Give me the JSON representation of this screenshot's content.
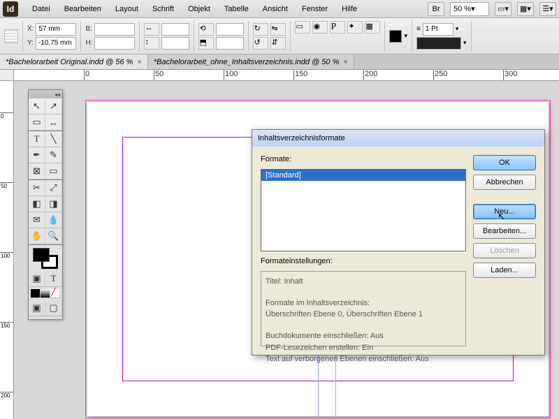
{
  "app": {
    "id": "Id"
  },
  "menu": [
    "Datei",
    "Bearbeiten",
    "Layout",
    "Schrift",
    "Objekt",
    "Tabelle",
    "Ansicht",
    "Fenster",
    "Hilfe"
  ],
  "menubar_right": {
    "br": "Br",
    "zoom": "50 %"
  },
  "control": {
    "x_label": "X:",
    "x": "57 mm",
    "y_label": "Y:",
    "y": "-10,75 mm",
    "b_label": "B:",
    "b": "",
    "h_label": "H:",
    "h": "",
    "stroke_weight": "1 Pt"
  },
  "tabs": [
    {
      "label": "*Bachelorarbeit Original.indd @ 56 %",
      "active": false
    },
    {
      "label": "*Bachelorarbeit_ohne_Inhaltsverzeichnis.indd @ 50 %",
      "active": true
    }
  ],
  "hruler_ticks": [
    "0",
    "50",
    "100",
    "150",
    "200",
    "250",
    "300"
  ],
  "vruler_ticks": [
    "0",
    "50",
    "100",
    "150",
    "200"
  ],
  "dialog": {
    "title": "Inhaltsverzeichnisformate",
    "formats_label": "Formate:",
    "formats": [
      "[Standard]"
    ],
    "settings_label": "Formateinstellungen:",
    "settings_text": {
      "title_line": "Titel: Inhalt",
      "sec1_head": "Formate im Inhaltsverzeichnis:",
      "sec1_body": "Überschriften Ebene 0, Überschriften Ebene 1",
      "opt1": "Buchdokumente einschließen: Aus",
      "opt2": "PDF-Lesezeichen erstellen: Ein",
      "opt3": "Text auf verborgenen Ebenen einschließen: Aus"
    },
    "buttons": {
      "ok": "OK",
      "cancel": "Abbrechen",
      "new": "Neu...",
      "edit": "Bearbeiten...",
      "delete": "Löschen",
      "load": "Laden..."
    }
  },
  "chart_data": null
}
